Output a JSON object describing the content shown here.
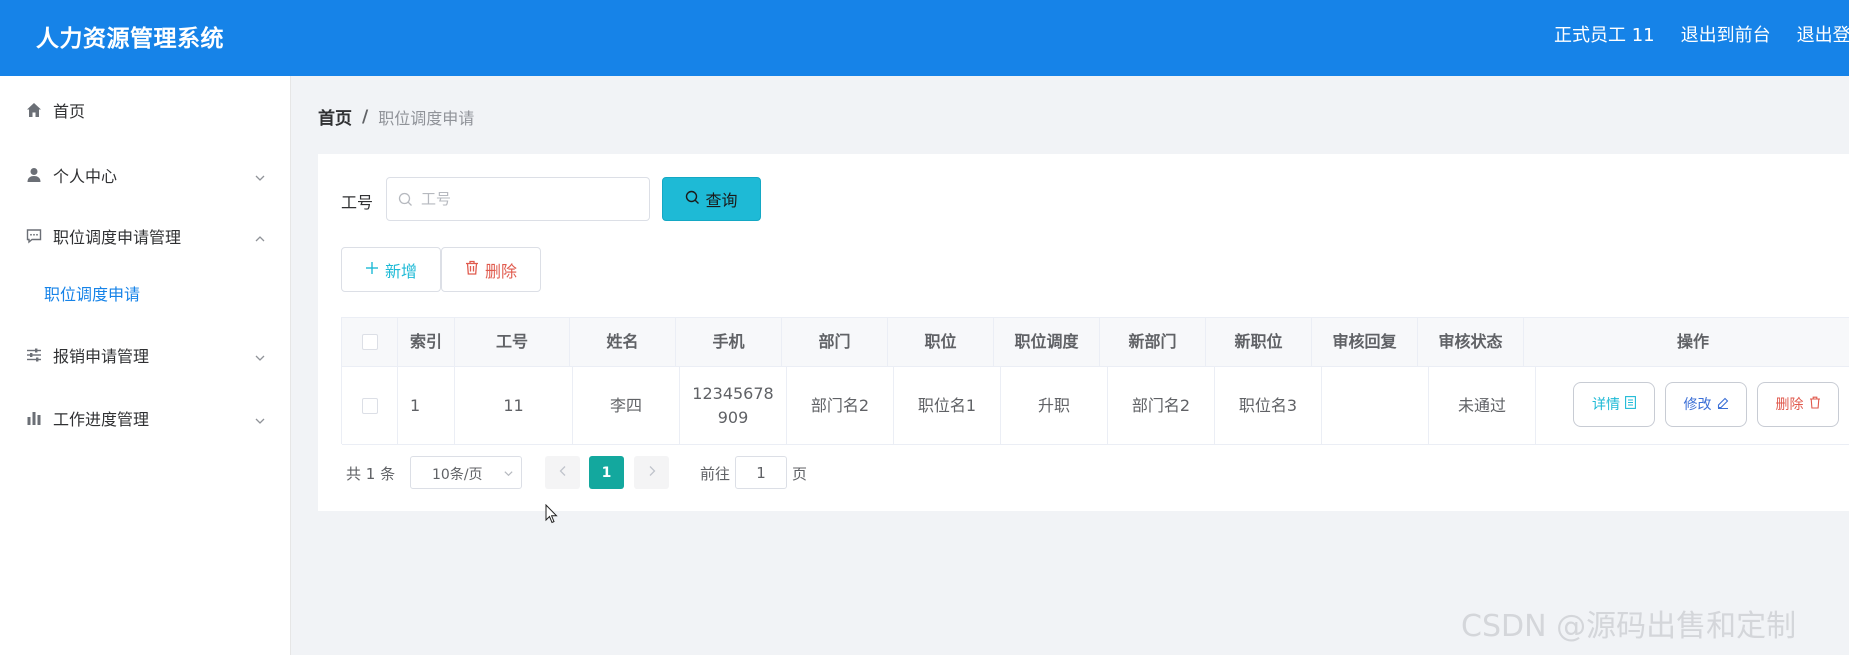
{
  "header": {
    "title": "人力资源管理系统",
    "links": [
      "正式员工 11",
      "退出到前台",
      "退出登录"
    ]
  },
  "sidebar": {
    "items": [
      {
        "label": "首页",
        "icon": "home-icon"
      },
      {
        "label": "个人中心",
        "icon": "user-icon"
      },
      {
        "label": "职位调度申请管理",
        "icon": "message-icon"
      },
      {
        "label": "报销申请管理",
        "icon": "sliders-icon"
      },
      {
        "label": "工作进度管理",
        "icon": "bar-chart-icon"
      }
    ],
    "submenu": {
      "label": "职位调度申请"
    }
  },
  "breadcrumb": {
    "home": "首页",
    "separator": "/",
    "current": "职位调度申请"
  },
  "search": {
    "label": "工号",
    "placeholder": "工号",
    "value": "",
    "button": "查询"
  },
  "actions": {
    "add": "新增",
    "delete": "删除"
  },
  "table": {
    "columns": [
      "索引",
      "工号",
      "姓名",
      "手机",
      "部门",
      "职位",
      "职位调度",
      "新部门",
      "新职位",
      "审核回复",
      "审核状态",
      "操作"
    ],
    "rows": [
      {
        "index": "1",
        "employee_id": "11",
        "name": "李四",
        "phone": "12345678909",
        "department": "部门名2",
        "position": "职位名1",
        "transfer": "升职",
        "new_department": "部门名2",
        "new_position": "职位名3",
        "review_reply": "",
        "review_status": "未通过",
        "ops": {
          "detail": "详情",
          "edit": "修改",
          "delete": "删除"
        }
      }
    ]
  },
  "pagination": {
    "total": "共 1 条",
    "page_size": "10条/页",
    "current_page": "1",
    "goto_label": "前往",
    "goto_value": "1",
    "goto_unit": "页"
  },
  "watermark": "CSDN @源码出售和定制",
  "colors": {
    "header_bg": "#1683e8",
    "accent": "#1ebad6",
    "danger": "#e05a4d",
    "page_active": "#13a89e"
  }
}
